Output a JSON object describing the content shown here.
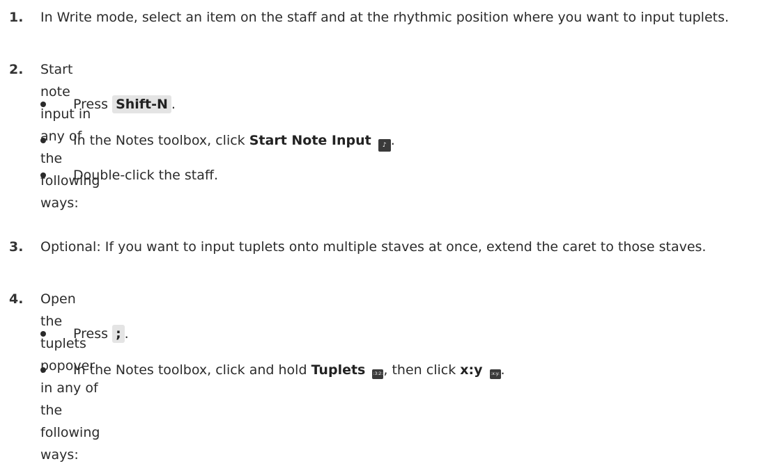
{
  "steps": [
    {
      "number": "1.",
      "text": "In Write mode, select an item on the staff and at the rhythmic position where you want to input tuplets."
    },
    {
      "number": "2.",
      "text": "Start note input in any of the following ways:"
    },
    {
      "number": "3.",
      "text": "Optional: If you want to input tuplets onto multiple staves at once, extend the caret to those staves."
    },
    {
      "number": "4.",
      "text": "Open the tuplets popover in any of the following ways:"
    }
  ],
  "step2_bullets": {
    "b1_prefix": "Press",
    "b1_key": "Shift-N",
    "b1_suffix": ".",
    "b2_prefix": "In the Notes toolbox, click",
    "b2_bold": "Start Note Input",
    "b2_suffix": ".",
    "b3_text": "Double-click the staff."
  },
  "step4_bullets": {
    "b1_prefix": "Press",
    "b1_key": ";",
    "b1_suffix": ".",
    "b2_prefix": "In the Notes toolbox, click and hold",
    "b2_bold": "Tuplets",
    "b2_mid": ", then click",
    "b2_bold2": "x:y",
    "b2_suffix": "."
  },
  "icons": {
    "start_note_input": "start-note-input-icon",
    "tuplets": "tuplets-icon",
    "xy": "xy-icon",
    "tuplets_glyph": ":3:2:",
    "xy_glyph": ":x:y:"
  }
}
